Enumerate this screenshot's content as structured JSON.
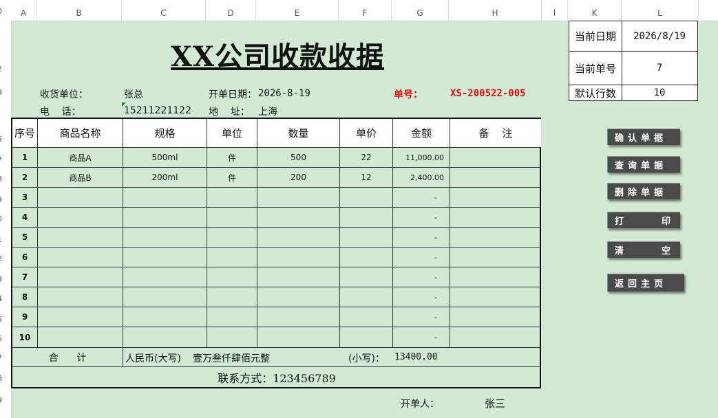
{
  "columns": [
    "A",
    "B",
    "C",
    "D",
    "E",
    "F",
    "G",
    "H",
    "I",
    "K",
    "L"
  ],
  "rows": [
    "0",
    "2",
    "3",
    "5",
    "7",
    "8",
    "9",
    "0",
    "1",
    "2",
    "3",
    "4",
    "5",
    "6",
    "7",
    "8",
    "9"
  ],
  "title": "XX公司收款收据",
  "header": {
    "customer_label": "收货单位：",
    "customer": "张总",
    "date_label": "开单日期：",
    "date": "2026-8-19",
    "order_no_label": "单号：",
    "order_no": "XS-200522-005",
    "phone_label": "电    话：",
    "phone": "15211221122",
    "address_label": "地    址：",
    "address": "上海"
  },
  "info": {
    "rows": [
      {
        "key": "当前日期",
        "value": "2026/8/19"
      },
      {
        "key": "当前单号",
        "value": "7"
      },
      {
        "key": "默认行数",
        "value": "10"
      }
    ]
  },
  "table": {
    "headers": [
      "序号",
      "商品名称",
      "规格",
      "单位",
      "数量",
      "单价",
      "金额",
      "备    注"
    ],
    "rows": [
      {
        "no": "1",
        "name": "商品A",
        "spec": "500ml",
        "unit": "件",
        "qty": "500",
        "price": "22",
        "amount": "11,000.00",
        "note": ""
      },
      {
        "no": "2",
        "name": "商品B",
        "spec": "200ml",
        "unit": "件",
        "qty": "200",
        "price": "12",
        "amount": "2,400.00",
        "note": ""
      },
      {
        "no": "3",
        "name": "",
        "spec": "",
        "unit": "",
        "qty": "",
        "price": "",
        "amount": "-",
        "note": ""
      },
      {
        "no": "4",
        "name": "",
        "spec": "",
        "unit": "",
        "qty": "",
        "price": "",
        "amount": "-",
        "note": ""
      },
      {
        "no": "5",
        "name": "",
        "spec": "",
        "unit": "",
        "qty": "",
        "price": "",
        "amount": "-",
        "note": ""
      },
      {
        "no": "6",
        "name": "",
        "spec": "",
        "unit": "",
        "qty": "",
        "price": "",
        "amount": "-",
        "note": ""
      },
      {
        "no": "7",
        "name": "",
        "spec": "",
        "unit": "",
        "qty": "",
        "price": "",
        "amount": "-",
        "note": ""
      },
      {
        "no": "8",
        "name": "",
        "spec": "",
        "unit": "",
        "qty": "",
        "price": "",
        "amount": "-",
        "note": ""
      },
      {
        "no": "9",
        "name": "",
        "spec": "",
        "unit": "",
        "qty": "",
        "price": "",
        "amount": "-",
        "note": ""
      },
      {
        "no": "10",
        "name": "",
        "spec": "",
        "unit": "",
        "qty": "",
        "price": "",
        "amount": "-",
        "note": ""
      }
    ],
    "total_label": "合      计",
    "total_upper_label": "人民币(大写)",
    "total_upper": "壹万叁仟肆佰元整",
    "total_lower_label": "(小写)：",
    "total_lower": "13400.00",
    "contact": "联系方式：123456789"
  },
  "footer": {
    "issuer_label": "开单人：",
    "issuer": "张三"
  },
  "buttons": {
    "confirm": "确认单据",
    "query": "查询单据",
    "delete": "删除单据",
    "print_a": "打",
    "print_b": "印",
    "clear_a": "清",
    "clear_b": "空",
    "home": "返回主页"
  }
}
